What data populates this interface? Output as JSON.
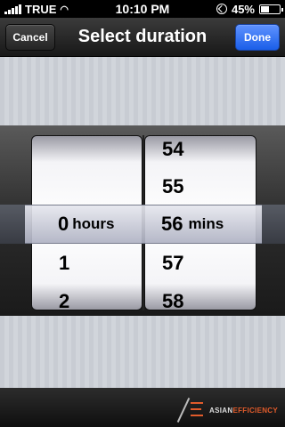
{
  "status_bar": {
    "carrier": "TRUE",
    "time": "10:10 PM",
    "battery_text": "45%",
    "battery_level": 0.45
  },
  "nav_bar": {
    "cancel_label": "Cancel",
    "title": "Select duration",
    "done_label": "Done"
  },
  "picker": {
    "hours_items": [
      "",
      "",
      "0",
      "1",
      "2"
    ],
    "minutes_items": [
      "54",
      "55",
      "56",
      "57",
      "58"
    ],
    "selected_hours": "0",
    "selected_hours_unit": "hours",
    "selected_minutes": "56",
    "selected_minutes_unit": "mins"
  },
  "footer": {
    "logo_part1": "ASIAN",
    "logo_part2": "EFFICIENCY"
  },
  "colors": {
    "done_button": "#1a5ee8",
    "logo_accent": "#e15b2b"
  }
}
